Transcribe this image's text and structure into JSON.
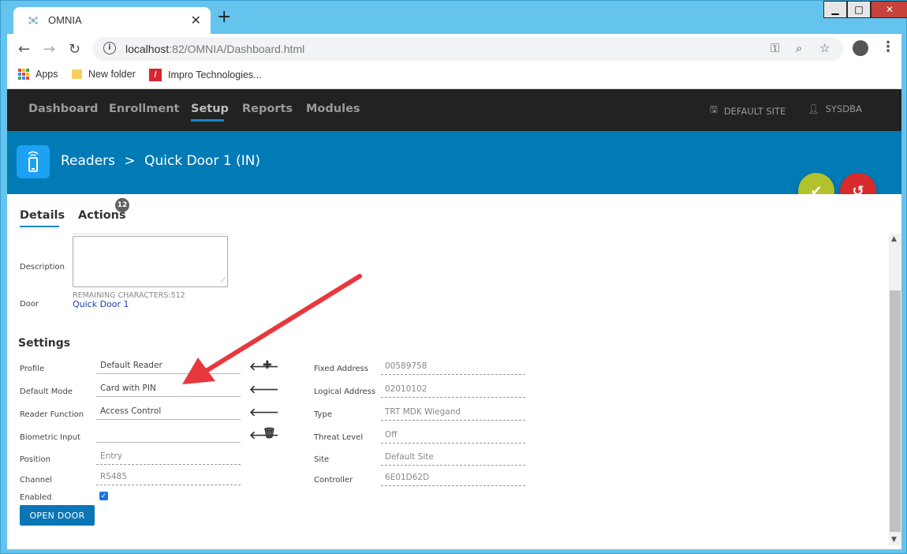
{
  "browser": {
    "tab_title": "OMNIA",
    "tab_close": "✕",
    "new_tab": "+",
    "url_host": "localhost",
    "url_rest": ":82/OMNIA/Dashboard.html",
    "bookmarks": [
      {
        "label": "Apps"
      },
      {
        "label": "New folder"
      },
      {
        "label": "Impro Technologies..."
      }
    ]
  },
  "nav": {
    "items": [
      {
        "label": "Dashboard"
      },
      {
        "label": "Enrollment"
      },
      {
        "label": "Setup"
      },
      {
        "label": "Reports"
      },
      {
        "label": "Modules"
      }
    ],
    "site": "DEFAULT SITE",
    "user": "SYSDBA"
  },
  "header": {
    "crumb_parent": "Readers",
    "crumb_sep": ">",
    "crumb_current": "Quick Door 1 (IN)"
  },
  "tabs": {
    "details": "Details",
    "actions": "Actions",
    "actions_badge": "12"
  },
  "details": {
    "description_label": "Description",
    "description_value": "",
    "remaining": "REMAINING CHARACTERS:512",
    "door_label": "Door",
    "door_value": "Quick Door 1"
  },
  "settings": {
    "title": "Settings",
    "left": [
      {
        "label": "Profile",
        "value": "Default Reader"
      },
      {
        "label": "Default Mode",
        "value": "Card with PIN"
      },
      {
        "label": "Reader Function",
        "value": "Access Control"
      },
      {
        "label": "Biometric Input",
        "value": ""
      },
      {
        "label": "Position",
        "value": "Entry"
      },
      {
        "label": "Channel",
        "value": "RS485"
      },
      {
        "label": "Enabled",
        "value": ""
      }
    ],
    "right": [
      {
        "label": "Fixed Address",
        "value": "00589758"
      },
      {
        "label": "Logical Address",
        "value": "02010102"
      },
      {
        "label": "Type",
        "value": "TRT MDK Wiegand"
      },
      {
        "label": "Threat Level",
        "value": "Off"
      },
      {
        "label": "Site",
        "value": "Default Site"
      },
      {
        "label": "Controller",
        "value": "6E01D62D"
      }
    ],
    "enabled": true,
    "open_door": "OPEN DOOR"
  },
  "colors": {
    "nav_bg": "#222222",
    "header_bg": "#007bb6",
    "accent": "#1587c9",
    "save": "#b2c22d",
    "undo": "#d82b2b",
    "annotation": "#e8383d"
  }
}
